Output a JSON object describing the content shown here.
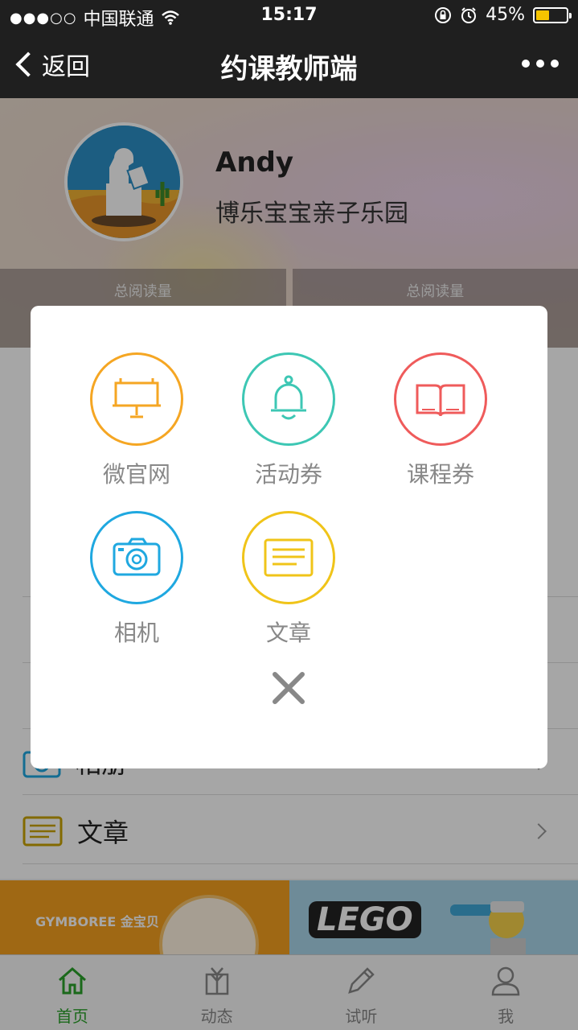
{
  "status_bar": {
    "carrier": "中国联通",
    "time": "15:17",
    "battery": "45%",
    "battery_level": 0.45
  },
  "nav": {
    "back_label": "返回",
    "title": "约课教师端"
  },
  "profile": {
    "name": "Andy",
    "org": "博乐宝宝亲子乐园",
    "stats": [
      {
        "label": "总阅读量"
      },
      {
        "label": "总阅读量"
      }
    ]
  },
  "background_list": {
    "album_label": "相册",
    "article_label": "文章"
  },
  "banner": {
    "left_brand": "GYMBOREE 金宝贝",
    "right_brand": "LEGO"
  },
  "menu": {
    "items": [
      {
        "label": "微官网",
        "icon": "billboard-icon",
        "color": "#f5a623"
      },
      {
        "label": "活动券",
        "icon": "bell-icon",
        "color": "#3dc7b4"
      },
      {
        "label": "课程券",
        "icon": "book-icon",
        "color": "#ef5b5b"
      },
      {
        "label": "相机",
        "icon": "camera-icon",
        "color": "#1fa8e0"
      },
      {
        "label": "文章",
        "icon": "article-icon",
        "color": "#f0c419"
      }
    ]
  },
  "tabs": [
    {
      "label": "首页",
      "icon": "home-icon",
      "active": true
    },
    {
      "label": "动态",
      "icon": "gift-icon",
      "active": false
    },
    {
      "label": "试听",
      "icon": "pencil-icon",
      "active": false
    },
    {
      "label": "我",
      "icon": "user-icon",
      "active": false
    }
  ],
  "colors": {
    "active_tab": "#2aa12a",
    "nav_bg": "#1f1f1f"
  }
}
